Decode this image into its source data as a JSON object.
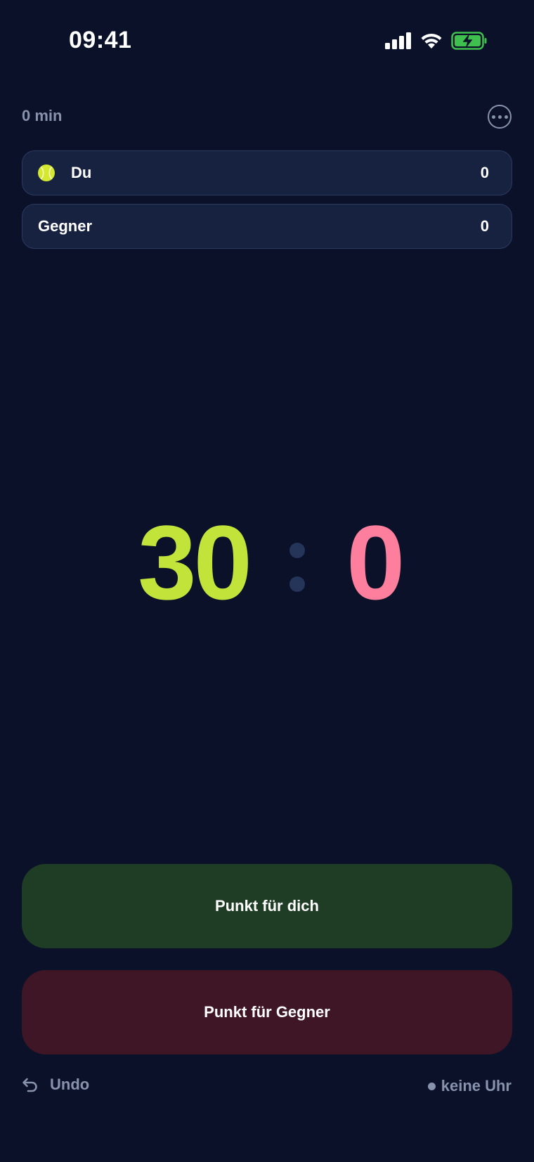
{
  "status_bar": {
    "time": "09:41",
    "icons": [
      "cellular-signal-icon",
      "wifi-icon",
      "battery-charging-icon"
    ]
  },
  "header": {
    "elapsed": "0 min",
    "more_icon": "ellipsis-circle-icon"
  },
  "players": [
    {
      "name": "Du",
      "games": "0",
      "serving": true,
      "serve_icon": "tennis-ball-icon"
    },
    {
      "name": "Gegner",
      "games": "0",
      "serving": false
    }
  ],
  "score": {
    "you": "30",
    "opponent": "0"
  },
  "actions": {
    "point_you": "Punkt für dich",
    "point_opponent": "Punkt für Gegner"
  },
  "footer": {
    "undo_label": "Undo",
    "undo_icon": "undo-arrow-icon",
    "clock_status": "keine Uhr"
  },
  "colors": {
    "background": "#0a1129",
    "card": "#172240",
    "you_accent": "#c2e43a",
    "opponent_accent": "#fe7f9d",
    "you_button": "#1e3d24",
    "opponent_button": "#3f1625",
    "muted_text": "#8893ab"
  }
}
